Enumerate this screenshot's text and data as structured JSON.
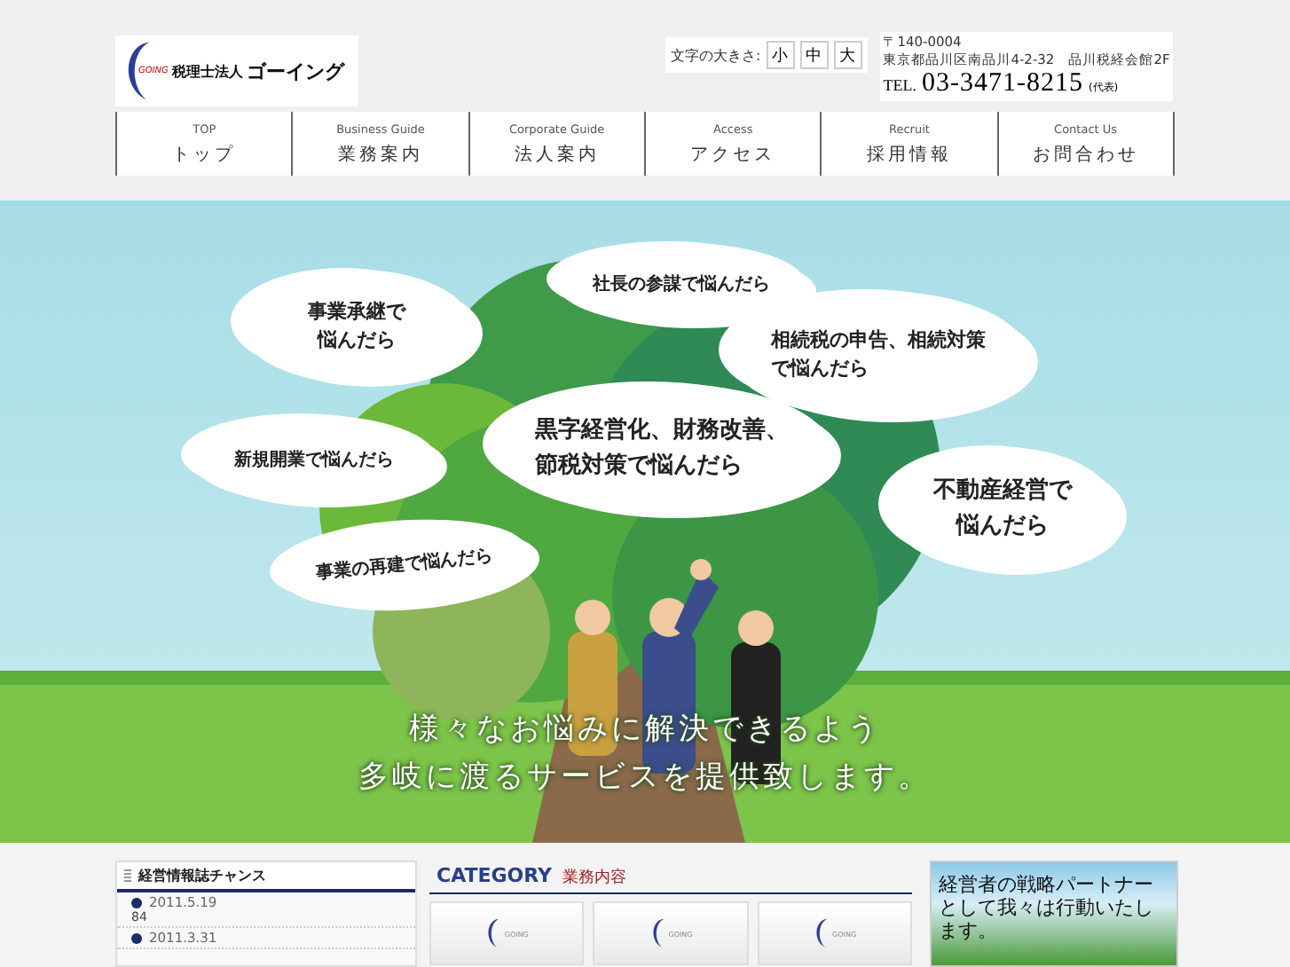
{
  "header": {
    "logo": {
      "mark": "GOING",
      "org_type": "税理士法人",
      "name": "ゴーイング"
    },
    "font_size": {
      "label": "文字の大きさ:",
      "buttons": [
        "小",
        "中",
        "大"
      ]
    },
    "address": {
      "postal": "〒140-0004",
      "street": "東京都品川区南品川4-2-32　品川税経会館2F",
      "tel_label": "TEL.",
      "tel": "03-3471-8215",
      "tel_note": "(代表)"
    }
  },
  "nav": [
    {
      "en": "TOP",
      "ja": "トップ"
    },
    {
      "en": "Business Guide",
      "ja": "業務案内"
    },
    {
      "en": "Corporate Guide",
      "ja": "法人案内"
    },
    {
      "en": "Access",
      "ja": "アクセス"
    },
    {
      "en": "Recruit",
      "ja": "採用情報"
    },
    {
      "en": "Contact Us",
      "ja": "お問合わせ"
    }
  ],
  "hero": {
    "bubbles": [
      {
        "text": "事業承継で悩んだら"
      },
      {
        "text": "社長の参謀で悩んだら"
      },
      {
        "text": "相続税の申告、相続対策で悩んだら"
      },
      {
        "text": "新規開業で悩んだら"
      },
      {
        "text": "黒字経営化、財務改善、節税対策で悩んだら"
      },
      {
        "text": "不動産経営で悩んだら"
      },
      {
        "text": "事業の再建で悩んだら"
      }
    ],
    "caption": [
      "様々なお悩みに解決できるよう",
      "多岐に渡るサービスを提供致します。"
    ]
  },
  "sidebar": {
    "title": "経営情報誌チャンス",
    "items": [
      {
        "date": "2011.5.19",
        "text": "84"
      },
      {
        "date": "2011.3.31"
      }
    ]
  },
  "category": {
    "title": "CATEGORY",
    "subtitle": "業務内容",
    "cards": [
      {
        "mark": "GOING"
      },
      {
        "mark": "GOING"
      },
      {
        "mark": "GOING"
      }
    ]
  },
  "banner": {
    "text": "経営者の戦略パートナーとして我々は行動いたします。"
  }
}
